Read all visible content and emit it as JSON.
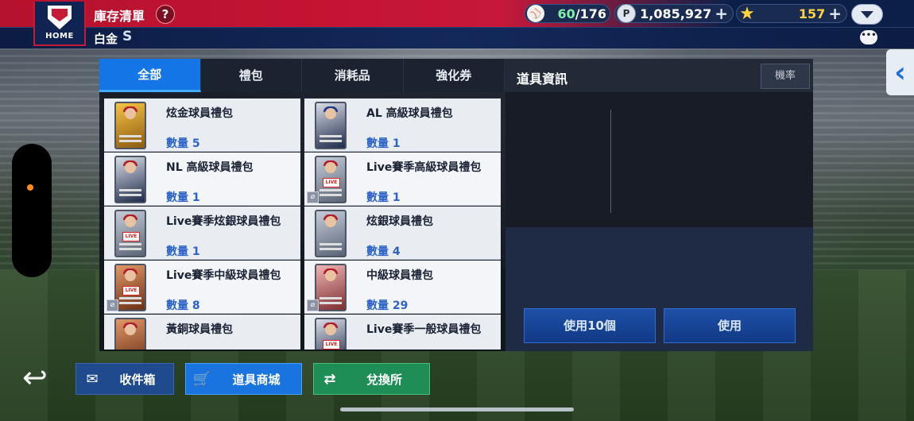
{
  "header": {
    "home_label": "HOME",
    "title": "庫存清單",
    "help_icon": "?",
    "subtitle": "白金",
    "grade": "S"
  },
  "currency": {
    "ball_count": "60",
    "ball_max": "/176",
    "points": "1,085,927",
    "stars": "157",
    "plus": "+"
  },
  "tabs": [
    {
      "label": "全部",
      "active": true
    },
    {
      "label": "禮包"
    },
    {
      "label": "消耗品"
    },
    {
      "label": "強化券"
    }
  ],
  "info": {
    "title": "道具資訊",
    "rate_button": "機率",
    "use10_button": "使用10個",
    "use_button": "使用"
  },
  "items": [
    {
      "name": "炫金球員禮包",
      "qty": "數量 5"
    },
    {
      "name": "AL 高級球員禮包",
      "qty": "數量 1"
    },
    {
      "name": "NL 高級球員禮包",
      "qty": "數量 1"
    },
    {
      "name": "Live賽季高級球員禮包",
      "qty": "數量 1"
    },
    {
      "name": "Live賽季炫銀球員禮包",
      "qty": "數量 1"
    },
    {
      "name": "炫銀球員禮包",
      "qty": "數量 4"
    },
    {
      "name": "Live賽季中級球員禮包",
      "qty": "數量 8"
    },
    {
      "name": "中級球員禮包",
      "qty": "數量 29"
    },
    {
      "name": "黃銅球員禮包",
      "qty": ""
    },
    {
      "name": "Live賽季一般球員禮包",
      "qty": ""
    }
  ],
  "bottom": {
    "mail": "收件箱",
    "shop": "道具商城",
    "exchange": "兌換所"
  },
  "colors": {
    "accent_blue": "#1375e6",
    "header_red": "#c31432",
    "header_navy": "#0b1f48",
    "exchange_green": "#1e8e56"
  }
}
